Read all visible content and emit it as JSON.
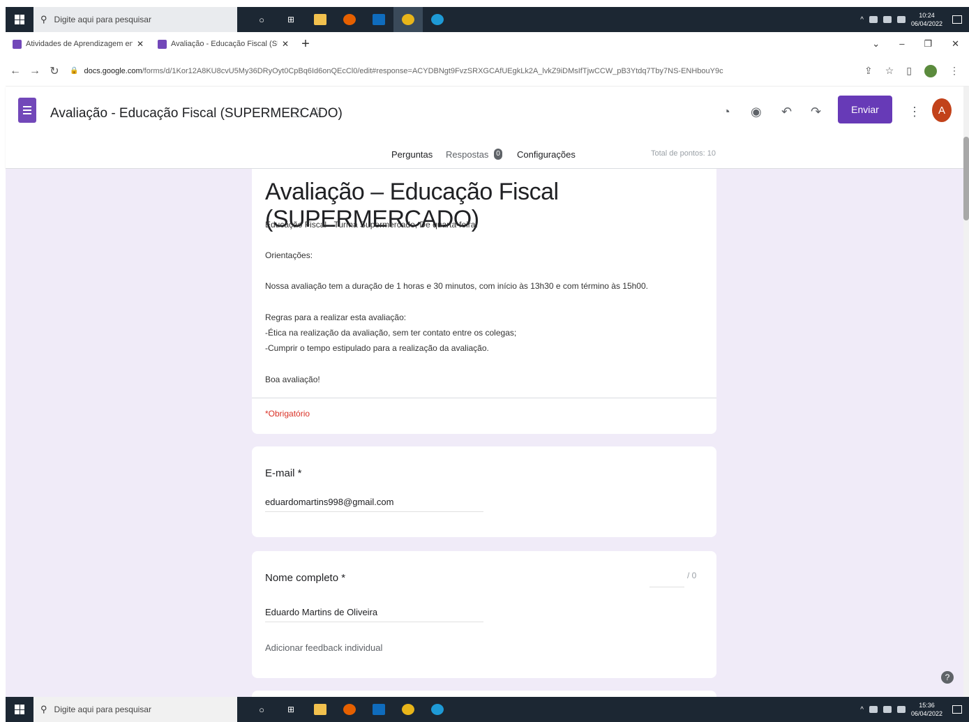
{
  "taskbar_top": {
    "search_placeholder": "Digite aqui para pesquisar",
    "clock_time": "10:24",
    "clock_date": "06/04/2022"
  },
  "taskbar_bottom": {
    "search_placeholder": "Digite aqui para pesquisar",
    "clock_time": "15:36",
    "clock_date": "06/04/2022"
  },
  "browser": {
    "tabs": [
      {
        "title": "Atividades de Aprendizagem en",
        "favicon_color": "#7248b9"
      },
      {
        "title": "Avaliação - Educação Fiscal (SUP",
        "favicon_color": "#7248b9"
      }
    ],
    "url_host": "docs.google.com",
    "url_path": "/forms/d/1Kor12A8KU8cvU5My36DRyOyt0CpBq6Id6onQEcCl0/edit#response=ACYDBNgt9FvzSRXGCAfUEgkLk2A_lvkZ9iDMsIfTjwCCW_pB3Ytdq7Tby7NS-ENHbouY9c"
  },
  "forms_header": {
    "doc_title": "Avaliação - Educação Fiscal (SUPERMERCADO)",
    "send_label": "Enviar",
    "avatar_initial": "A",
    "tabs": {
      "questions": "Perguntas",
      "responses": "Respostas",
      "responses_count": "0",
      "settings": "Configurações"
    },
    "total_points": "Total de pontos: 10"
  },
  "form": {
    "title": "Avaliação – Educação Fiscal (SUPERMERCADO)",
    "description_lines": [
      "Educação Fiscal - Turma Supermercado, De quarta-feira.",
      "Orientações:",
      "Nossa avaliação tem a duração de  1 horas e 30 minutos, com início às 13h30 e com término às 15h00.",
      "Regras para a realizar esta avaliação:",
      "-Ética na realização da avaliação, sem ter contato entre os colegas;",
      "-Cumprir o tempo estipulado para a realização da avaliação.",
      "Boa avaliação!"
    ],
    "required_note": "*Obrigatório",
    "email_label": "E-mail *",
    "email_value": "eduardomartins998@gmail.com",
    "name_label": "Nome completo *",
    "name_value": "Eduardo Martins de Oliveira",
    "name_points": "/ 0",
    "feedback_label": "Adicionar feedback individual"
  },
  "colors": {
    "accent": "#673ab7",
    "page_bg": "#f0ebf8",
    "required": "#d93025"
  }
}
